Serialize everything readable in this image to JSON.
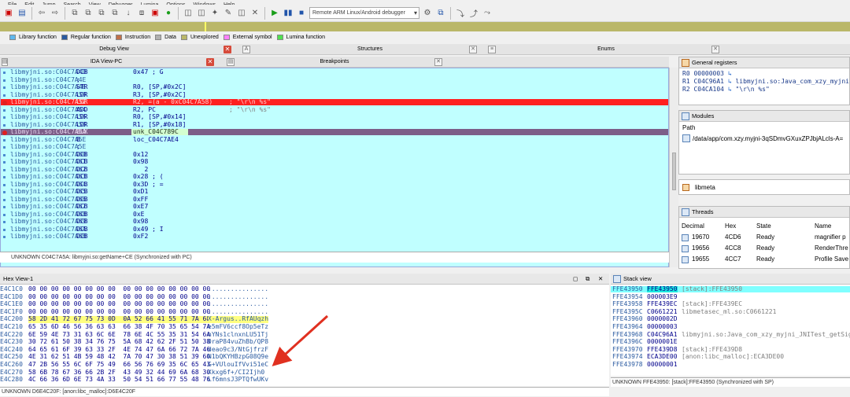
{
  "menu": [
    "File",
    "Edit",
    "Jump",
    "Search",
    "View",
    "Debugger",
    "Lumina",
    "Options",
    "Windows",
    "Help"
  ],
  "toolbar": {
    "debugger": "Remote ARM Linux/Android debugger"
  },
  "legend": [
    {
      "label": "Library function",
      "color": "#5fb8ee"
    },
    {
      "label": "Regular function",
      "color": "#2a5aa0"
    },
    {
      "label": "Instruction",
      "color": "#c0704a"
    },
    {
      "label": "Data",
      "color": "#b0b0b0"
    },
    {
      "label": "Unexplored",
      "color": "#bab769"
    },
    {
      "label": "External symbol",
      "color": "#ff80ff"
    },
    {
      "label": "Lumina function",
      "color": "#50e050"
    }
  ],
  "tabs_top": {
    "debug_view": "Debug View",
    "structures": "Structures",
    "enums": "Enums"
  },
  "tabs_ida": {
    "ida_view": "IDA View-PC",
    "breakpoints": "Breakpoints"
  },
  "ida_lines": [
    {
      "addr": "libmyjni.so:C04C7A4D",
      "mn": "DCB",
      "op": "0x47 ; G",
      "cm": ""
    },
    {
      "addr": "libmyjni.so:C04C7A4E",
      "mn": ";",
      "op": "",
      "cm": ""
    },
    {
      "addr": "libmyjni.so:C04C7A4E",
      "mn": "STR",
      "op": "R0, [SP,#0x2C]",
      "cm": ""
    },
    {
      "addr": "libmyjni.so:C04C7A50",
      "mn": "LDR",
      "op": "R3, [SP,#0x2C]",
      "cm": ""
    },
    {
      "addr": "libmyjni.so:C04C7A52",
      "mn": "LDR",
      "op": "R2, =(a - 0xC04C7A58)",
      "cm": "; \"\\r\\n %s\""
    },
    {
      "addr": "libmyjni.so:C04C7A54",
      "mn": "ADD",
      "op": "R2, PC",
      "cm": "; \"\\r\\n %s\""
    },
    {
      "addr": "libmyjni.so:C04C7A56",
      "mn": "LDR",
      "op": "R0, [SP,#0x14]",
      "cm": ""
    },
    {
      "addr": "libmyjni.so:C04C7A58",
      "mn": "LDR",
      "op": "R1, [SP,#0x18]",
      "cm": ""
    },
    {
      "addr": "libmyjni.so:C04C7A5A",
      "mn": "BLX",
      "op": "unk_C04C789C",
      "cm": ""
    },
    {
      "addr": "libmyjni.so:C04C7A5E",
      "mn": "B",
      "op": "loc_C04C7AE4",
      "cm": ""
    },
    {
      "addr": "libmyjni.so:C04C7A5E",
      "mn": ";",
      "op": "",
      "cm": ""
    },
    {
      "addr": "libmyjni.so:C04C7A60",
      "mn": "DCB",
      "op": "0x12",
      "cm": ""
    },
    {
      "addr": "libmyjni.so:C04C7A61",
      "mn": "DCB",
      "op": "0x98",
      "cm": ""
    },
    {
      "addr": "libmyjni.so:C04C7A62",
      "mn": "DCB",
      "op": "   2",
      "cm": ""
    },
    {
      "addr": "libmyjni.so:C04C7A63",
      "mn": "DCB",
      "op": "0x28 ; (",
      "cm": ""
    },
    {
      "addr": "libmyjni.so:C04C7A64",
      "mn": "DCB",
      "op": "0x3D ; =",
      "cm": ""
    },
    {
      "addr": "libmyjni.so:C04C7A65",
      "mn": "DCB",
      "op": "0xD1",
      "cm": ""
    },
    {
      "addr": "libmyjni.so:C04C7A66",
      "mn": "DCB",
      "op": "0xFF",
      "cm": ""
    },
    {
      "addr": "libmyjni.so:C04C7A67",
      "mn": "DCB",
      "op": "0xE7",
      "cm": ""
    },
    {
      "addr": "libmyjni.so:C04C7A68",
      "mn": "DCB",
      "op": "0xE",
      "cm": ""
    },
    {
      "addr": "libmyjni.so:C04C7A69",
      "mn": "DCB",
      "op": "0x98",
      "cm": ""
    },
    {
      "addr": "libmyjni.so:C04C7A6A",
      "mn": "DCB",
      "op": "0x49 ; I",
      "cm": ""
    },
    {
      "addr": "libmyjni.so:C04C7A6B",
      "mn": "DCB",
      "op": "0xF2",
      "cm": ""
    }
  ],
  "ida_status": "UNKNOWN C04C7A5A: libmyjni.so:getName+CE (Synchronized with PC)",
  "registers": {
    "title": "General registers",
    "rows": [
      {
        "reg": "R0",
        "val": "00000003",
        "desc": ""
      },
      {
        "reg": "R1",
        "val": "C04C96A1",
        "desc": "libmyjni.so:Java_com_xzy_myjni_J"
      },
      {
        "reg": "R2",
        "val": "C04CA104",
        "desc": "\"\\r\\n %s\""
      }
    ]
  },
  "modules": {
    "title": "Modules",
    "col": "Path",
    "path": "/data/app/com.xzy.myjni-3qSDmvGXuxZPJbjALcls-A="
  },
  "lib_search": "libmeta",
  "threads": {
    "title": "Threads",
    "cols": [
      "Decimal",
      "Hex",
      "State",
      "Name"
    ],
    "rows": [
      {
        "dec": "19670",
        "hex": "4CD6",
        "state": "Ready",
        "name": "magnifier p"
      },
      {
        "dec": "19656",
        "hex": "4CC8",
        "state": "Ready",
        "name": "RenderThre"
      },
      {
        "dec": "19655",
        "hex": "4CC7",
        "state": "Ready",
        "name": "Profile Save"
      }
    ]
  },
  "hex_view": {
    "title": "Hex View-1",
    "rows": [
      {
        "a": "E4C1C0",
        "b": "00 00 00 00 00 00 00 00  00 00 00 00 00 00 00 00",
        "s": "................"
      },
      {
        "a": "E4C1D0",
        "b": "00 00 00 00 00 00 00 00  00 00 00 00 00 00 00 00",
        "s": "................"
      },
      {
        "a": "E4C1E0",
        "b": "00 00 00 00 00 00 00 00  00 00 00 00 00 00 00 00",
        "s": "................"
      },
      {
        "a": "E4C1F0",
        "b": "00 00 00 00 00 00 00 00  00 00 00 00 00 00 00 00",
        "s": "................"
      },
      {
        "a": "E4C200",
        "b": "58 2D 41 72 67 75 73 0D  0A 52 66 41 55 71 7A 68",
        "s": "X-Argus..RfAUqzh"
      },
      {
        "a": "E4C210",
        "b": "65 35 6D 46 56 36 63 63  66 38 4F 70 35 65 54 7A",
        "s": "e5mFV6ccf8Op5eTz"
      },
      {
        "a": "E4C220",
        "b": "6E 59 4E 73 31 63 6C 6E  78 6E 4C 55 35 31 54 6A",
        "s": "nYNs1clnxnLU51Tj"
      },
      {
        "a": "E4C230",
        "b": "30 72 61 50 38 34 76 75  5A 68 42 62 2F 51 50 38",
        "s": "0raP84vuZhBb/QP8"
      },
      {
        "a": "E4C240",
        "b": "64 65 61 6F 39 63 33 2F  4E 74 47 6A 66 72 7A 46",
        "s": "deao9c3/NtGjfrzF"
      },
      {
        "a": "E4C250",
        "b": "4E 31 62 51 4B 59 48 42  7A 70 47 30 38 51 39 60",
        "s": "N1bQKYHBzpG08Q9e"
      },
      {
        "a": "E4C260",
        "b": "47 2B 56 55 6C 6F 75 49  66 56 76 69 35 6C 65 43",
        "s": "G+VUlouIfVvi51eC"
      },
      {
        "a": "E4C270",
        "b": "58 6B 78 67 36 66 2B 2F  43 49 32 44 69 6A 68 30",
        "s": "Xkxg6f+/CI2Ijh0"
      },
      {
        "a": "E4C280",
        "b": "4C 66 36 6D 6E 73 4A 33  50 54 51 66 77 55 48 76",
        "s": "Lf6mnsJ3PTQfwUKv"
      }
    ],
    "status": "UNKNOWN D6E4C20F: [anon:libc_malloc]:D6E4C20F"
  },
  "stack_view": {
    "title": "Stack view",
    "rows": [
      {
        "a": "FFE43950",
        "v": "FFE43950",
        "c": "[stack]:FFE43950"
      },
      {
        "a": "FFE43954",
        "v": "000003E9",
        "c": ""
      },
      {
        "a": "FFE43958",
        "v": "FFE439EC",
        "c": "[stack]:FFE439EC"
      },
      {
        "a": "FFE4395C",
        "v": "C0661221",
        "c": "libmetasec_ml.so:C0661221"
      },
      {
        "a": "FFE43960",
        "v": "0000002D",
        "c": ""
      },
      {
        "a": "FFE43964",
        "v": "00000003",
        "c": ""
      },
      {
        "a": "FFE43968",
        "v": "C04C96A1",
        "c": "libmyjni.so:Java_com_xzy_myjni_JNITest_getSign"
      },
      {
        "a": "FFE4396C",
        "v": "0000001E",
        "c": ""
      },
      {
        "a": "FFE43970",
        "v": "FFE439D8",
        "c": "[stack]:FFE439D8"
      },
      {
        "a": "FFE43974",
        "v": "ECA3DE00",
        "c": "[anon:libc_malloc]:ECA3DE00"
      },
      {
        "a": "FFE43978",
        "v": "00000001",
        "c": ""
      }
    ],
    "status": "UNKNOWN FFE43950: [stack]:FFE43950 (Synchronized with SP)"
  },
  "colors": {
    "ida_bg": "#c0ffff",
    "pc_highlight": "#ff2020",
    "bp_highlight": "#7c5e88",
    "arrow": "#e03020"
  }
}
